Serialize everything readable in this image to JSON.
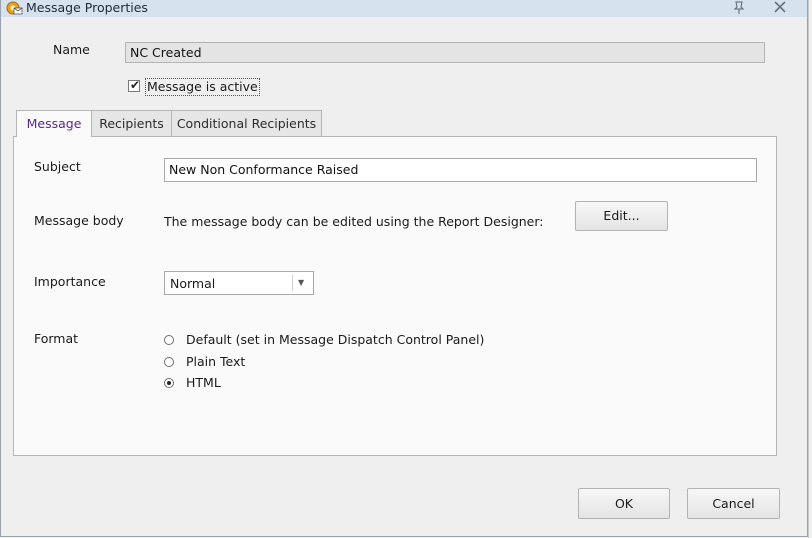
{
  "window": {
    "title": "Message Properties"
  },
  "form": {
    "name_label": "Name",
    "name_value": "NC Created",
    "active_label": "Message is active",
    "active_checked": true
  },
  "tabs": [
    {
      "label": "Message",
      "active": true
    },
    {
      "label": "Recipients",
      "active": false
    },
    {
      "label": "Conditional Recipients",
      "active": false
    }
  ],
  "message": {
    "subject_label": "Subject",
    "subject_value": "New Non Conformance Raised",
    "body_label": "Message body",
    "body_text": "The message body can be edited using the Report Designer:",
    "edit_button": "Edit...",
    "importance_label": "Importance",
    "importance_value": "Normal",
    "format_label": "Format",
    "format_options": [
      {
        "label": "Default (set in Message Dispatch Control Panel)",
        "selected": false
      },
      {
        "label": "Plain Text",
        "selected": false
      },
      {
        "label": "HTML",
        "selected": true
      }
    ]
  },
  "buttons": {
    "ok": "OK",
    "cancel": "Cancel"
  },
  "colors": {
    "active_tab_text": "#5a2a8a",
    "titlebar": "#d7e2ef"
  },
  "icons": {
    "app": "gear-envelope-icon",
    "pin": "pin-icon",
    "close": "close-icon",
    "dropdown": "chevron-down-icon"
  }
}
